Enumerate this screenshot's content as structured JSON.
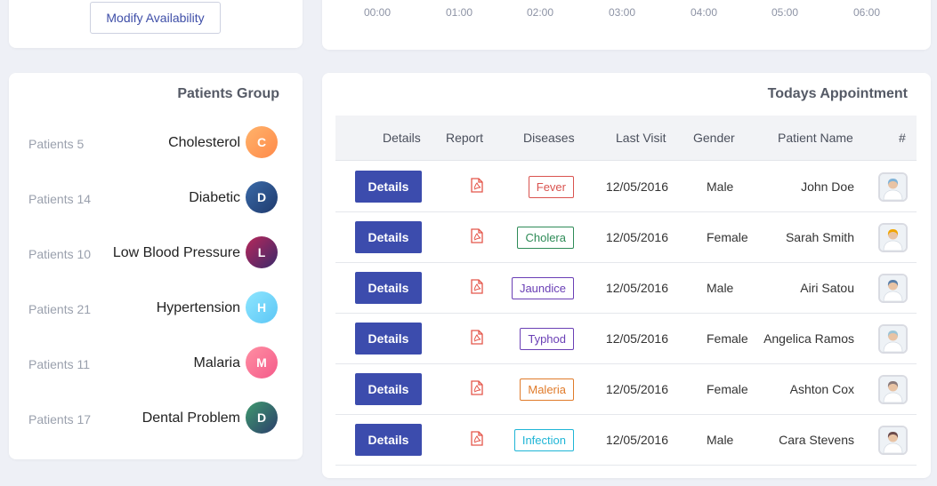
{
  "availability": {
    "modify_label": "Modify Availability"
  },
  "chart_axis": {
    "ticks": [
      "00:00",
      "01:00",
      "02:00",
      "03:00",
      "04:00",
      "05:00",
      "06:00"
    ]
  },
  "patients_group": {
    "title": "Patients Group",
    "items": [
      {
        "count": "Patients 5",
        "name": "Cholesterol",
        "initial": "C",
        "gradient": [
          "#ffb36b",
          "#ff8a4a"
        ]
      },
      {
        "count": "Patients 14",
        "name": "Diabetic",
        "initial": "D",
        "gradient": [
          "#3a6aa8",
          "#1f3a6d"
        ]
      },
      {
        "count": "Patients 10",
        "name": "Low Blood Pressure",
        "initial": "L",
        "gradient": [
          "#b8275a",
          "#3b2a6b"
        ]
      },
      {
        "count": "Patients 21",
        "name": "Hypertension",
        "initial": "H",
        "gradient": [
          "#8ee6ff",
          "#5cc6f5"
        ]
      },
      {
        "count": "Patients 11",
        "name": "Malaria",
        "initial": "M",
        "gradient": [
          "#ff8fa3",
          "#f45b8a"
        ]
      },
      {
        "count": "Patients 17",
        "name": "Dental Problem",
        "initial": "D",
        "gradient": [
          "#3f9a6e",
          "#2c3e6b"
        ]
      }
    ]
  },
  "appointments": {
    "title": "Todays Appointment",
    "headers": {
      "details": "Details",
      "report": "Report",
      "diseases": "Diseases",
      "last_visit": "Last Visit",
      "gender": "Gender",
      "patient_name": "Patient Name",
      "index": "#"
    },
    "rows": [
      {
        "details": "Details",
        "disease": "Fever",
        "disease_color": "#d9534f",
        "last_visit": "12/05/2016",
        "gender": "Male",
        "name": "John Doe",
        "avatar_color": "#7fb3d8"
      },
      {
        "details": "Details",
        "disease": "Cholera",
        "disease_color": "#2e8b57",
        "last_visit": "12/05/2016",
        "gender": "Female",
        "name": "Sarah Smith",
        "avatar_color": "#f0a500"
      },
      {
        "details": "Details",
        "disease": "Jaundice",
        "disease_color": "#6a3fb5",
        "last_visit": "12/05/2016",
        "gender": "Male",
        "name": "Airi Satou",
        "avatar_color": "#5a7fa8"
      },
      {
        "details": "Details",
        "disease": "Typhod",
        "disease_color": "#6a3fb5",
        "last_visit": "12/05/2016",
        "gender": "Female",
        "name": "Angelica Ramos",
        "avatar_color": "#9bc4d6"
      },
      {
        "details": "Details",
        "disease": "Maleria",
        "disease_color": "#e07b2a",
        "last_visit": "12/05/2016",
        "gender": "Female",
        "name": "Ashton Cox",
        "avatar_color": "#8a7a7a"
      },
      {
        "details": "Details",
        "disease": "Infection",
        "disease_color": "#1fb5d6",
        "last_visit": "12/05/2016",
        "gender": "Male",
        "name": "Cara Stevens",
        "avatar_color": "#6b4a4a"
      }
    ]
  }
}
